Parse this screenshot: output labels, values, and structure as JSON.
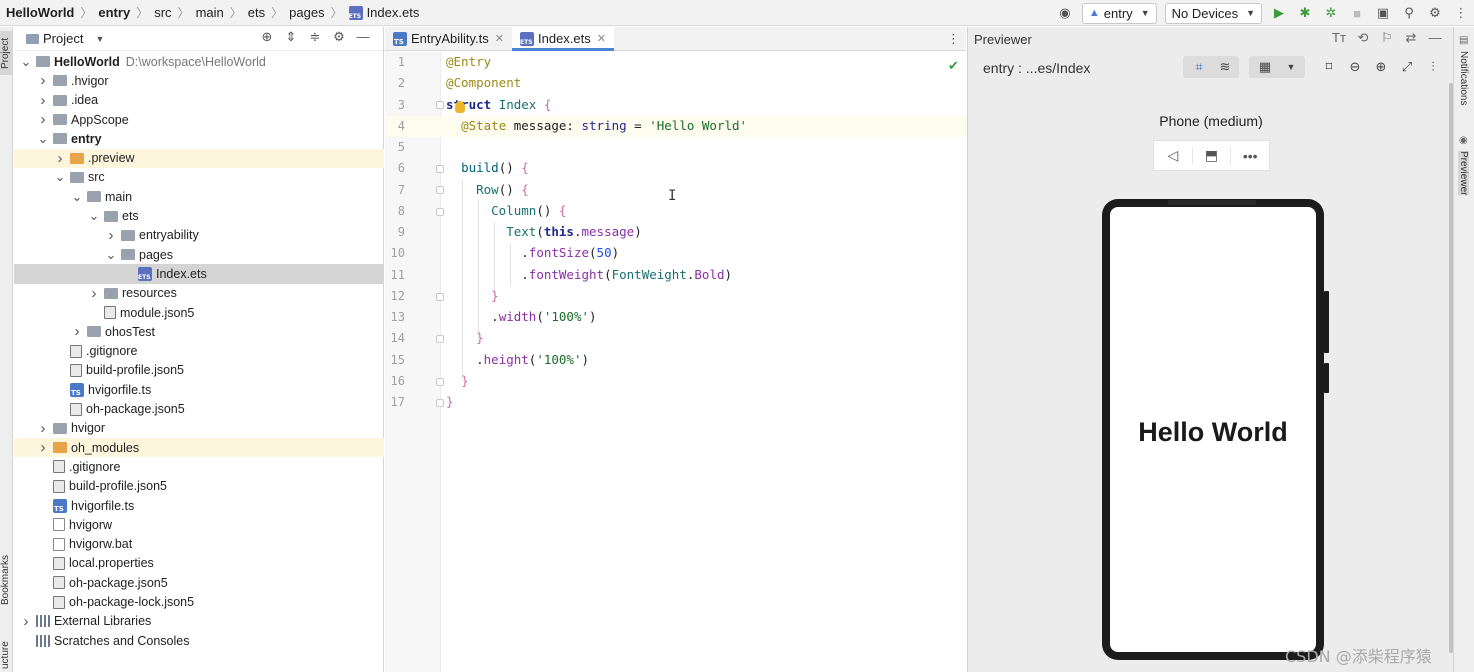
{
  "breadcrumb": {
    "items": [
      "HelloWorld",
      "entry",
      "src",
      "main",
      "ets",
      "pages",
      "Index.ets"
    ]
  },
  "toolbar": {
    "module_combo": "entry",
    "device_combo": "No Devices"
  },
  "left_strip": {
    "project_label": "Project",
    "bookmarks_label": "Bookmarks",
    "structure_label": "ucture"
  },
  "project_panel": {
    "title": "Project",
    "tree": [
      {
        "label": "HelloWorld",
        "extra": "D:\\workspace\\HelloWorld",
        "depth": 0,
        "icon": "folder",
        "arrow": "down",
        "bold": true
      },
      {
        "label": ".hvigor",
        "depth": 1,
        "icon": "folder",
        "arrow": "right"
      },
      {
        "label": ".idea",
        "depth": 1,
        "icon": "folder",
        "arrow": "right"
      },
      {
        "label": "AppScope",
        "depth": 1,
        "icon": "folder",
        "arrow": "right"
      },
      {
        "label": "entry",
        "depth": 1,
        "icon": "folder",
        "arrow": "down",
        "bold": true
      },
      {
        "label": ".preview",
        "depth": 2,
        "icon": "folder-orange",
        "arrow": "right",
        "highlight": "yellow"
      },
      {
        "label": "src",
        "depth": 2,
        "icon": "folder",
        "arrow": "down"
      },
      {
        "label": "main",
        "depth": 3,
        "icon": "folder",
        "arrow": "down"
      },
      {
        "label": "ets",
        "depth": 4,
        "icon": "folder",
        "arrow": "down"
      },
      {
        "label": "entryability",
        "depth": 5,
        "icon": "folder",
        "arrow": "right"
      },
      {
        "label": "pages",
        "depth": 5,
        "icon": "folder",
        "arrow": "down"
      },
      {
        "label": "Index.ets",
        "depth": 6,
        "icon": "ets",
        "arrow": "",
        "highlight": "selected"
      },
      {
        "label": "resources",
        "depth": 4,
        "icon": "folder",
        "arrow": "right"
      },
      {
        "label": "module.json5",
        "depth": 4,
        "icon": "gear",
        "arrow": ""
      },
      {
        "label": "ohosTest",
        "depth": 3,
        "icon": "folder",
        "arrow": "right"
      },
      {
        "label": ".gitignore",
        "depth": 2,
        "icon": "gear",
        "arrow": ""
      },
      {
        "label": "build-profile.json5",
        "depth": 2,
        "icon": "gear",
        "arrow": ""
      },
      {
        "label": "hvigorfile.ts",
        "depth": 2,
        "icon": "ts",
        "arrow": ""
      },
      {
        "label": "oh-package.json5",
        "depth": 2,
        "icon": "gear",
        "arrow": ""
      },
      {
        "label": "hvigor",
        "depth": 1,
        "icon": "folder",
        "arrow": "right"
      },
      {
        "label": "oh_modules",
        "depth": 1,
        "icon": "folder-orange",
        "arrow": "right",
        "highlight": "yellow"
      },
      {
        "label": ".gitignore",
        "depth": 1,
        "icon": "gear",
        "arrow": ""
      },
      {
        "label": "build-profile.json5",
        "depth": 1,
        "icon": "gear",
        "arrow": ""
      },
      {
        "label": "hvigorfile.ts",
        "depth": 1,
        "icon": "ts",
        "arrow": ""
      },
      {
        "label": "hvigorw",
        "depth": 1,
        "icon": "file",
        "arrow": ""
      },
      {
        "label": "hvigorw.bat",
        "depth": 1,
        "icon": "file",
        "arrow": ""
      },
      {
        "label": "local.properties",
        "depth": 1,
        "icon": "gear",
        "arrow": ""
      },
      {
        "label": "oh-package.json5",
        "depth": 1,
        "icon": "gear",
        "arrow": ""
      },
      {
        "label": "oh-package-lock.json5",
        "depth": 1,
        "icon": "gear",
        "arrow": ""
      },
      {
        "label": "External Libraries",
        "depth": 0,
        "icon": "lib",
        "arrow": "right"
      },
      {
        "label": "Scratches and Consoles",
        "depth": 0,
        "icon": "lib",
        "arrow": ""
      }
    ]
  },
  "editor": {
    "tabs": [
      {
        "label": "EntryAbility.ts",
        "icon": "ts",
        "active": false
      },
      {
        "label": "Index.ets",
        "icon": "ets",
        "active": true
      }
    ],
    "line_numbers": [
      "1",
      "2",
      "3",
      "4",
      "5",
      "6",
      "7",
      "8",
      "9",
      "10",
      "11",
      "12",
      "13",
      "14",
      "15",
      "16",
      "17"
    ],
    "code_lines": [
      "@Entry",
      "@Component",
      "struct Index {",
      "  @State message: string = 'Hello World'",
      "",
      "  build() {",
      "    Row() {",
      "      Column() {",
      "        Text(this.message)",
      "          .fontSize(50)",
      "          .fontWeight(FontWeight.Bold)",
      "      }",
      "      .width('100%')",
      "    }",
      "    .height('100%')",
      "  }",
      "}"
    ]
  },
  "previewer": {
    "title": "Previewer",
    "route": "entry : ...es/Index",
    "device_name": "Phone (medium)",
    "screen_text": "Hello World"
  },
  "right_strip": {
    "notifications_label": "Notifications",
    "previewer_label": "Previewer"
  },
  "watermark": "CSDN @添柴程序猿"
}
